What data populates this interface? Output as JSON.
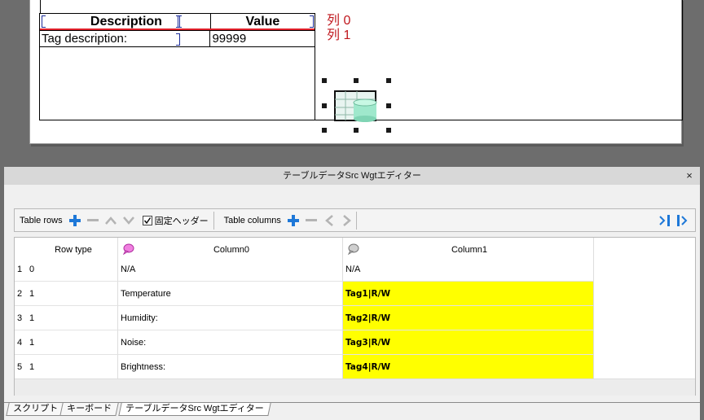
{
  "preview": {
    "header": [
      "Description",
      "Value"
    ],
    "row": [
      "Tag description:",
      "99999"
    ],
    "column_labels": [
      "列 0",
      "列 1"
    ]
  },
  "editor": {
    "title": "テーブルデータSrc Wgtエディター",
    "close": "×"
  },
  "toolbar": {
    "rows_label": "Table rows",
    "fixed_header_label": "固定ヘッダー",
    "fixed_header_checked": true,
    "columns_label": "Table columns"
  },
  "grid": {
    "headers": {
      "row_type": "Row type",
      "col0": "Column0",
      "col1": "Column1"
    },
    "rows": [
      {
        "num": "1",
        "type": "0",
        "col0": "N/A",
        "col1": "N/A",
        "highlight": false
      },
      {
        "num": "2",
        "type": "1",
        "col0": "Temperature",
        "col1": "Tag1|R/W",
        "highlight": true
      },
      {
        "num": "3",
        "type": "1",
        "col0": "Humidity:",
        "col1": "Tag2|R/W",
        "highlight": true
      },
      {
        "num": "4",
        "type": "1",
        "col0": "Noise:",
        "col1": "Tag3|R/W",
        "highlight": true
      },
      {
        "num": "5",
        "type": "1",
        "col0": "Brightness:",
        "col1": "Tag4|R/W",
        "highlight": true
      }
    ],
    "highlight_color": "#ffff00"
  },
  "tabs": [
    "スクリプト",
    "キーボード",
    "テーブルデータSrc Wgtエディター"
  ],
  "colors": {
    "accent_blue": "#1e78d8",
    "grid_red": "#e0202a",
    "label_red": "#c0181e"
  }
}
